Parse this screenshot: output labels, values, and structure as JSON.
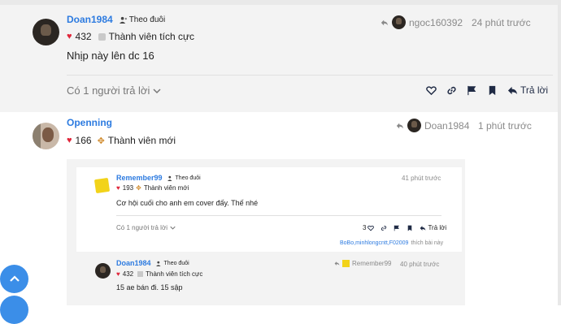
{
  "post1": {
    "username": "Doan1984",
    "follow_label": "Theo đuôi",
    "reply_to_user": "ngoc160392",
    "time": "24 phút trước",
    "likes": "432",
    "badge": "Thành viên tích cực",
    "text": "Nhịp này lên dc 16",
    "replies_toggle": "Có 1 người trả lời",
    "reply_button": "Trả lời"
  },
  "post2": {
    "username": "Openning",
    "reply_to_user": "Doan1984",
    "time": "1 phút trước",
    "likes": "166",
    "badge": "Thành viên mới"
  },
  "quote1": {
    "username": "Remember99",
    "follow_label": "Theo đuôi",
    "time": "41 phút trước",
    "likes": "193",
    "badge": "Thành viên mới",
    "text": "Cơ hội cuối cho anh em cover đấy. Thế nhé",
    "replies_toggle": "Có 1 người trả lời",
    "like_count": "3",
    "reply_button": "Trả lời",
    "liked_by": "BoBo,minhlongcntt,F02009",
    "liked_suffix": "thích bài này"
  },
  "quote2": {
    "username": "Doan1984",
    "follow_label": "Theo đuôi",
    "reply_to_user": "Remember99",
    "time": "40 phút trước",
    "likes": "432",
    "badge": "Thành viên tích cực",
    "text": "15 ae bán đi. 15 sập"
  },
  "colors": {
    "accent": "#2d7be0",
    "heart": "#e0263a",
    "fab": "#3b8ee8"
  },
  "icons": [
    "person-plus-icon",
    "reply-arrow-icon",
    "heart-icon",
    "link-icon",
    "flag-icon",
    "bookmark-icon",
    "reply-icon",
    "chevron-down-icon",
    "chevron-up-icon",
    "badge-icon"
  ]
}
